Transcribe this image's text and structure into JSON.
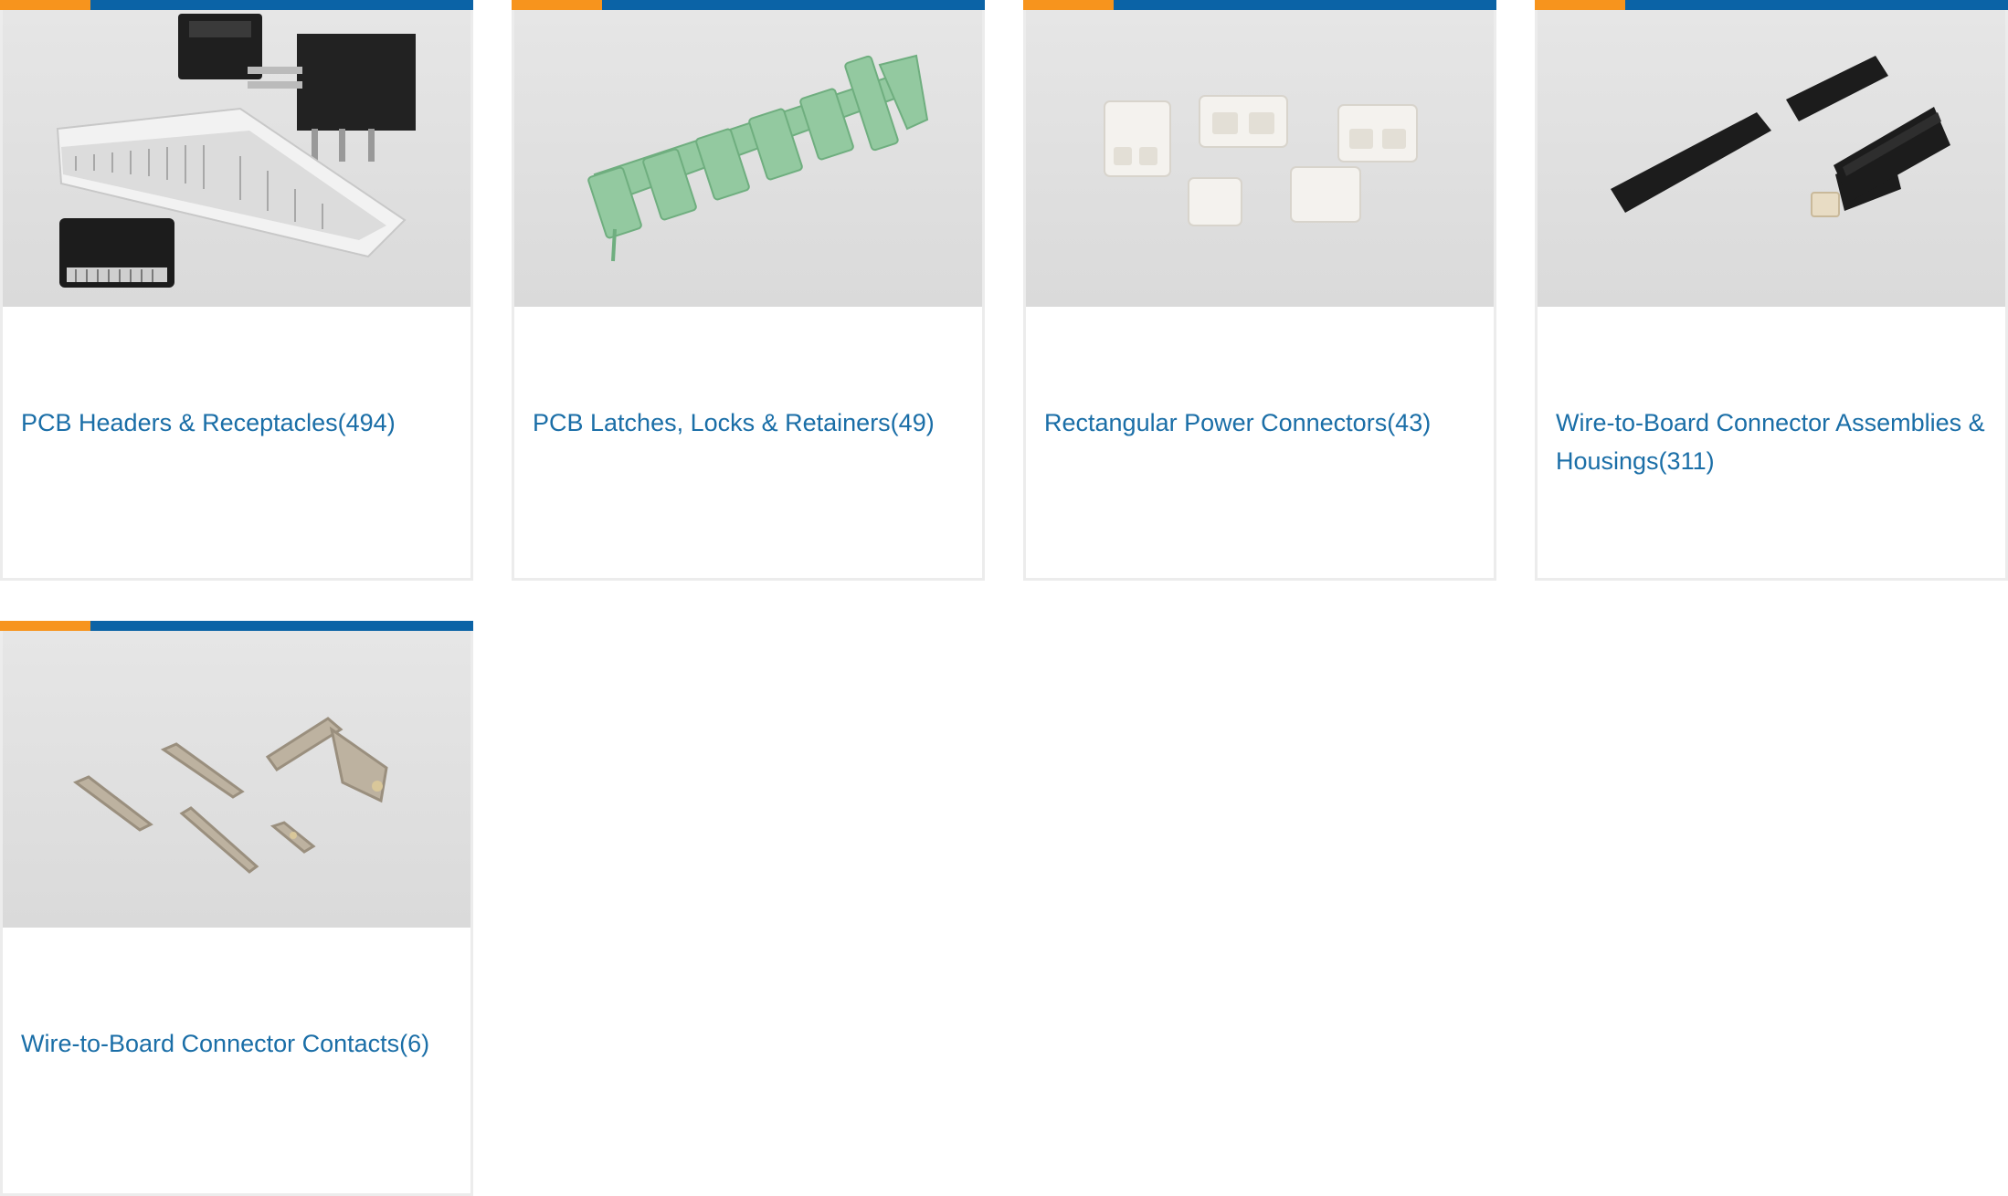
{
  "colors": {
    "accent": "#f7941d",
    "brand": "#0b63a6",
    "link": "#1a6ea7",
    "card_border": "#ececec",
    "photo_bg": "#dedede"
  },
  "categories": [
    {
      "label": "PCB Headers & Receptacles(494)",
      "image_icon": "pcb-header-connector-icon"
    },
    {
      "label": "PCB Latches, Locks & Retainers(49)",
      "image_icon": "pcb-latch-icon"
    },
    {
      "label": "Rectangular Power Connectors(43)",
      "image_icon": "power-connector-icon"
    },
    {
      "label": "Wire-to-Board Connector Assemblies & Housings(311)",
      "image_icon": "wire-to-board-housing-icon"
    },
    {
      "label": "Wire-to-Board Connector Contacts(6)",
      "image_icon": "crimp-contact-icon"
    }
  ]
}
